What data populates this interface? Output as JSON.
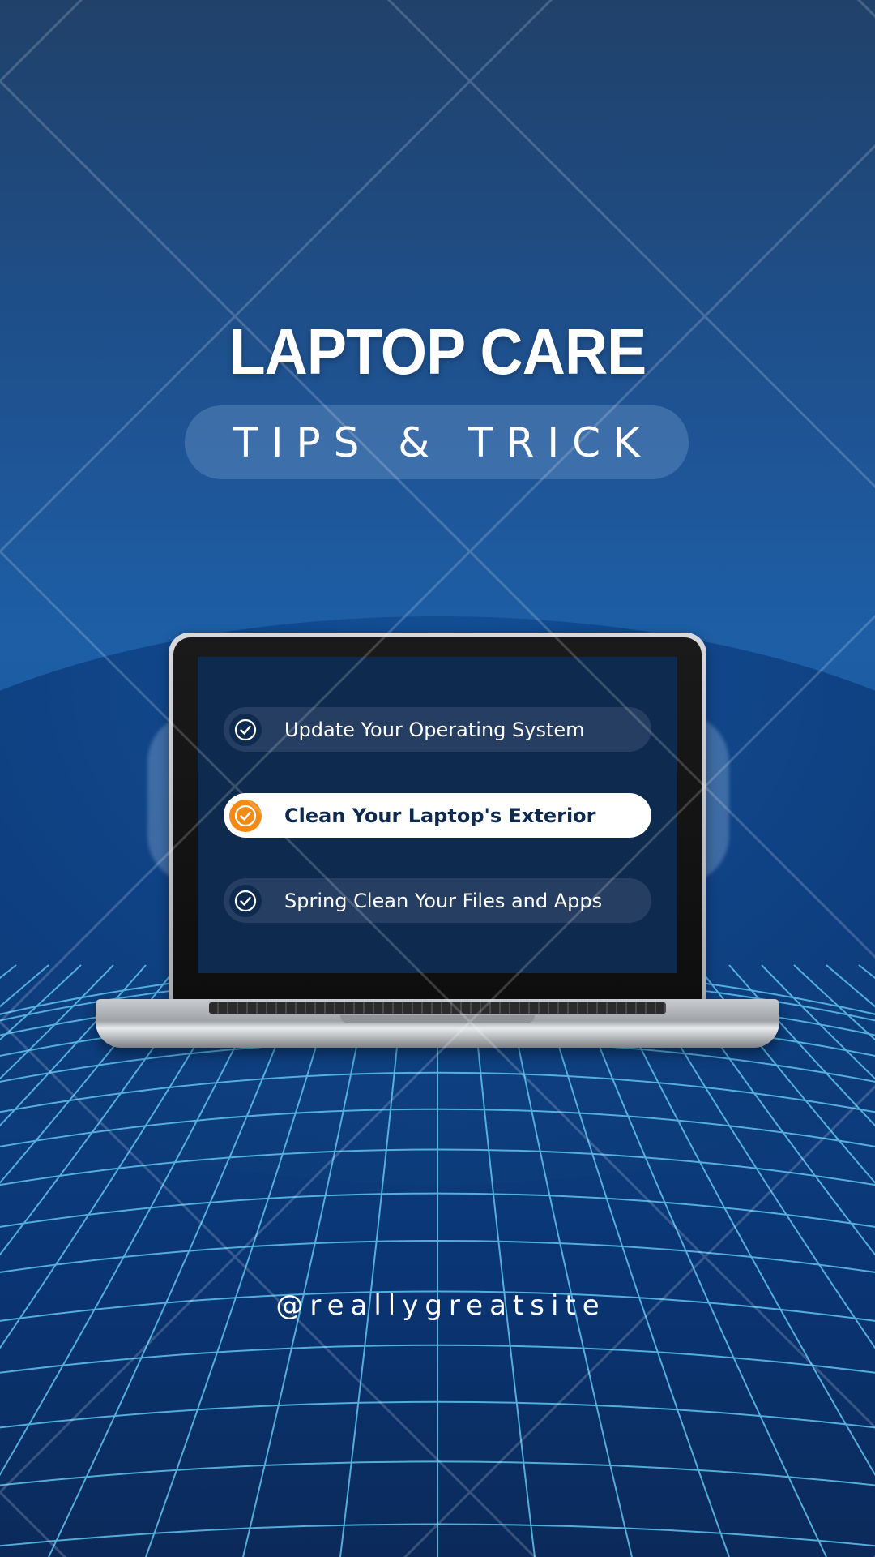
{
  "header": {
    "title": "LAPTOP CARE",
    "subtitle": "TIPS & TRICK"
  },
  "tips": [
    {
      "label": "Update Your Operating System",
      "state": "default",
      "icon": "check-circle-icon"
    },
    {
      "label": "Clean Your Laptop's Exterior",
      "state": "highlighted",
      "icon": "check-circle-icon"
    },
    {
      "label": "Spring Clean Your Files and Apps",
      "state": "default",
      "icon": "check-circle-icon"
    }
  ],
  "footer": {
    "handle": "@reallygreatsite"
  },
  "colors": {
    "background": "#1e5495",
    "screen": "#0e2a4e",
    "highlight_icon": "#f48a14",
    "grid_lines": "#5fc4f0"
  }
}
